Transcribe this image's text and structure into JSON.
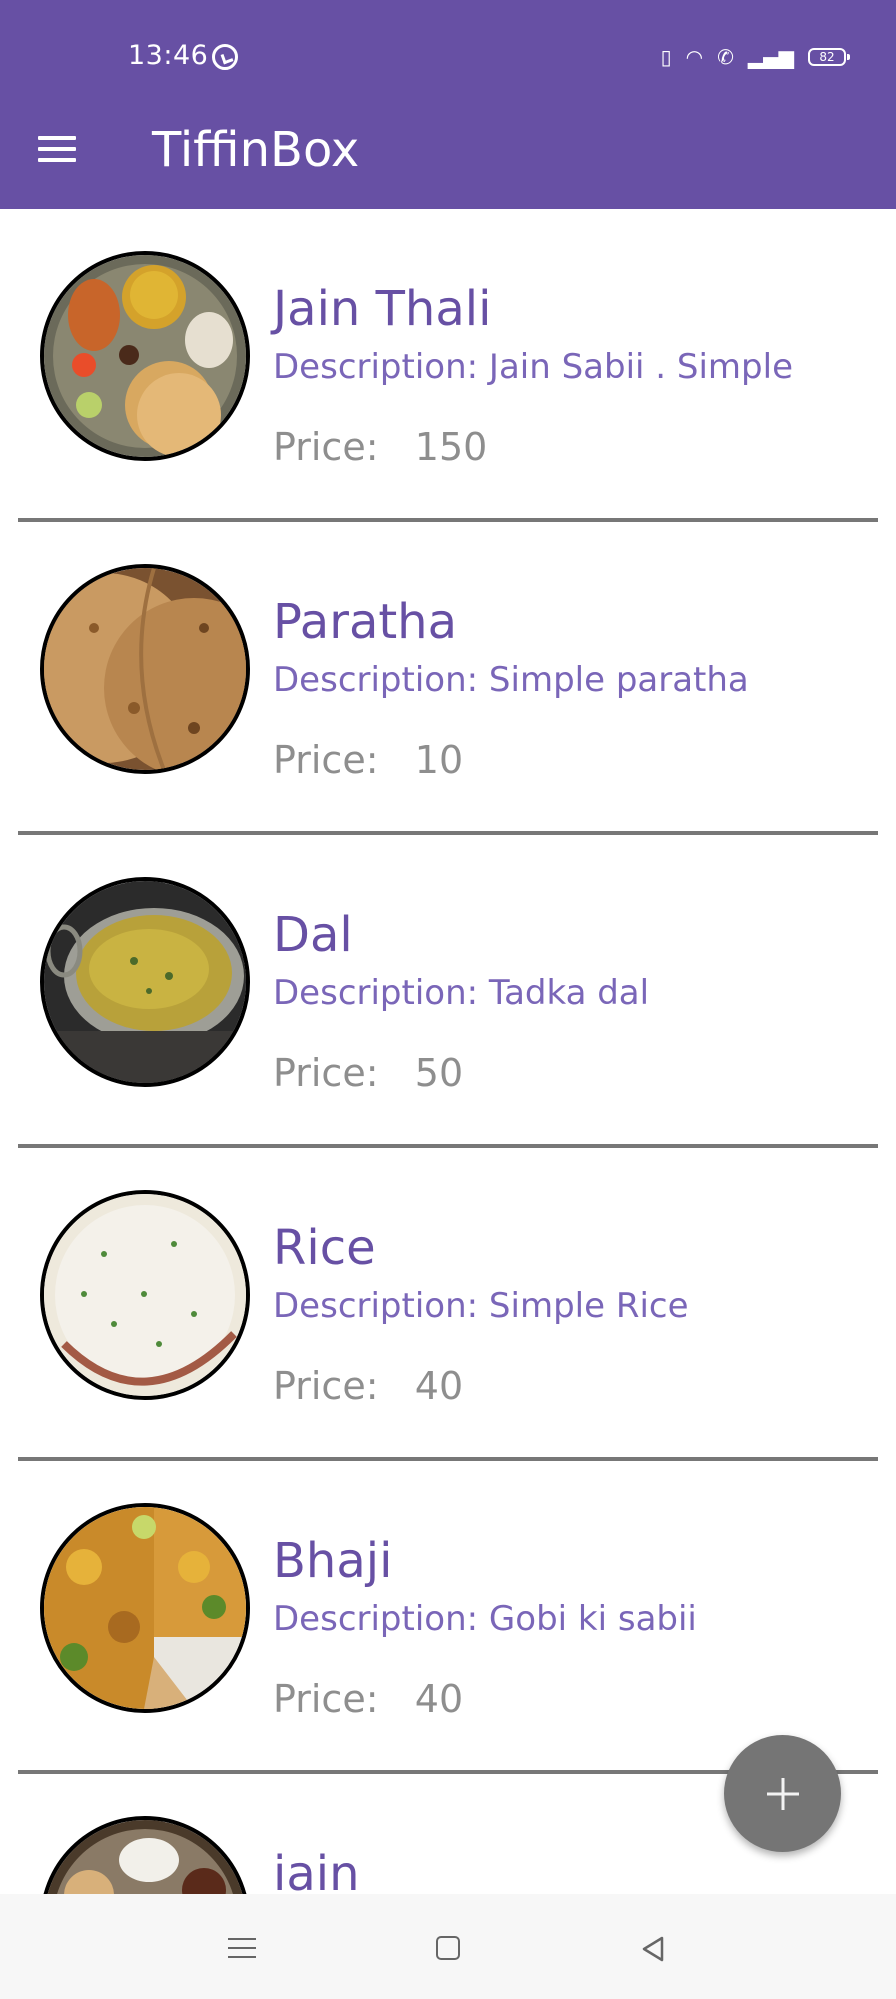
{
  "status_bar": {
    "time": "13:46",
    "battery": "82"
  },
  "app_bar": {
    "title": "TiffinBox"
  },
  "labels": {
    "description_prefix": "Description:",
    "price_prefix": "Price:"
  },
  "items": [
    {
      "name": "Jain Thali",
      "description": "Jain Sabii . Simple",
      "price": "150"
    },
    {
      "name": "Paratha",
      "description": "Simple paratha",
      "price": "10"
    },
    {
      "name": "Dal",
      "description": "Tadka dal",
      "price": "50"
    },
    {
      "name": "Rice",
      "description": "Simple Rice",
      "price": "40"
    },
    {
      "name": "Bhaji",
      "description": "Gobi ki sabii",
      "price": "40"
    },
    {
      "name": "iain",
      "description": "",
      "price": ""
    }
  ],
  "fab": {
    "icon": "plus-icon"
  },
  "colors": {
    "primary": "#6750A4",
    "fab": "#757575"
  }
}
